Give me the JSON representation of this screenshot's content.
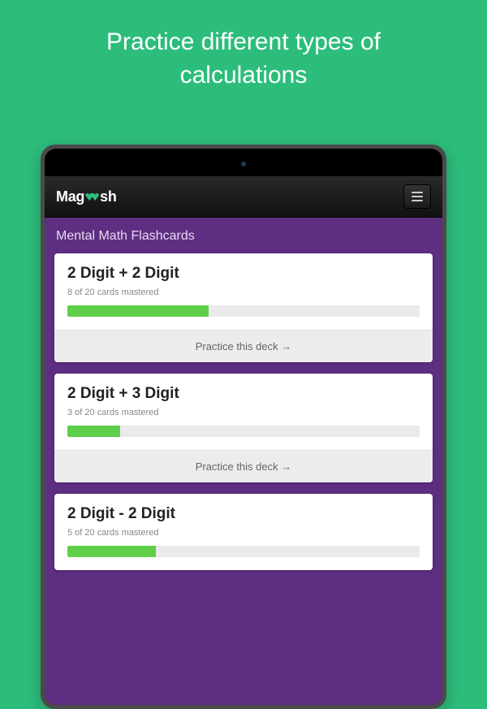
{
  "hero": "Practice different types of calculations",
  "logo": {
    "pre": "Mag",
    "post": "sh"
  },
  "section_title": "Mental Math Flashcards",
  "action_label": "Practice this deck →",
  "decks": [
    {
      "title": "2 Digit + 2 Digit",
      "mastered": 8,
      "total": 20,
      "sub": "8 of 20 cards mastered",
      "pct": 40
    },
    {
      "title": "2 Digit + 3 Digit",
      "mastered": 3,
      "total": 20,
      "sub": "3 of 20 cards mastered",
      "pct": 15
    },
    {
      "title": "2 Digit - 2 Digit",
      "mastered": 5,
      "total": 20,
      "sub": "5 of 20 cards mastered",
      "pct": 25
    }
  ]
}
